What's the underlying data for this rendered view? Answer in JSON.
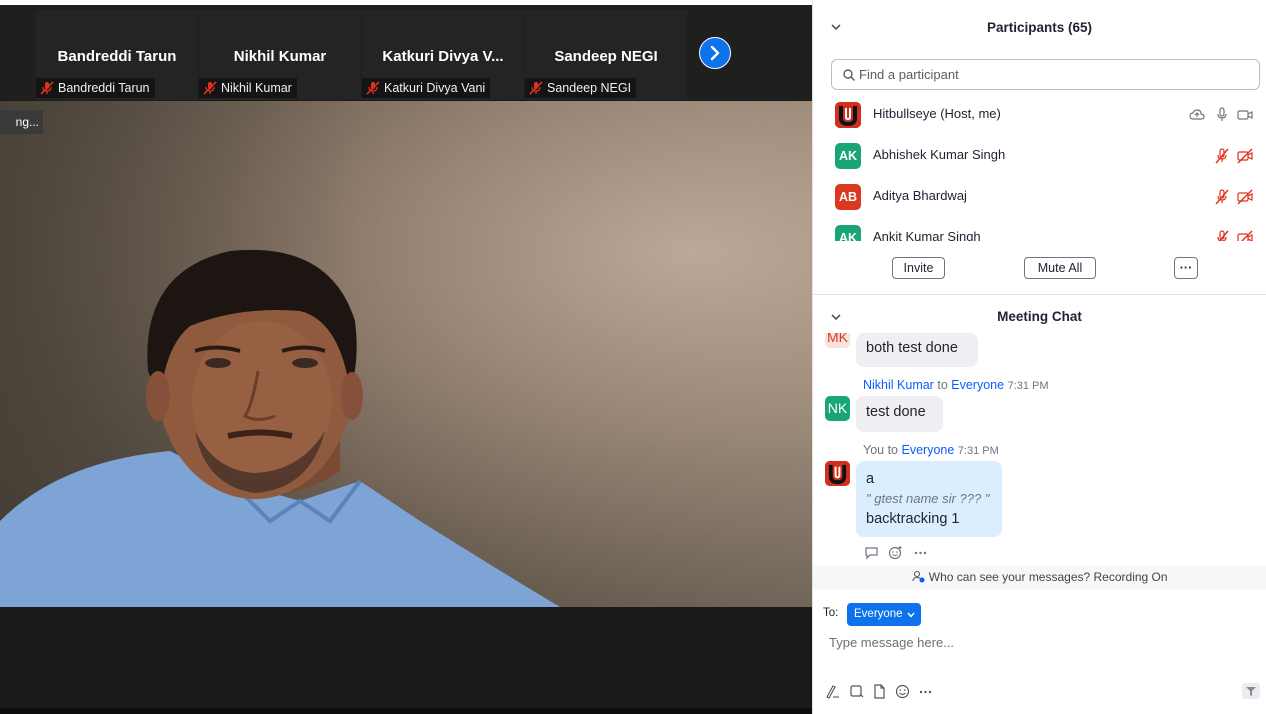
{
  "gallery": {
    "tiles": [
      {
        "name": "Bandreddi Tarun",
        "label": "Bandreddi Tarun"
      },
      {
        "name": "Nikhil  Kumar",
        "label": "Nikhil  Kumar"
      },
      {
        "name": "Katkuri Divya V...",
        "label": "Katkuri Divya Vani"
      },
      {
        "name": "Sandeep  NEGI",
        "label": "Sandeep  NEGI"
      }
    ]
  },
  "main_video": {
    "status_text": "ng..."
  },
  "participants": {
    "title": "Participants (65)",
    "search_placeholder": "Find a participant",
    "list": [
      {
        "name": "Hitbullseye (Host, me)",
        "initials": "",
        "avatar_color": "#d32f1f"
      },
      {
        "name": "Abhishek Kumar Singh",
        "initials": "AK",
        "avatar_color": "#1aa574"
      },
      {
        "name": "Aditya Bhardwaj",
        "initials": "AB",
        "avatar_color": "#d9391f"
      },
      {
        "name": "Ankit Kumar Singh",
        "initials": "AK",
        "avatar_color": "#1aa574"
      }
    ],
    "invite_label": "Invite",
    "mute_all_label": "Mute All",
    "more_label": "···"
  },
  "chat": {
    "title": "Meeting Chat",
    "messages": [
      {
        "initials": "MK",
        "text": "both test done"
      },
      {
        "sender": "Nikhil  Kumar",
        "to_word": "to",
        "recipient": "Everyone",
        "time": "7:31 PM",
        "initials": "NK",
        "text": "test done"
      },
      {
        "sender": "You",
        "to_word": "to",
        "recipient": "Everyone",
        "time": "7:31 PM",
        "line1": "a",
        "quote": "\" gtest name sir ??? \"",
        "line3": "backtracking 1"
      }
    ],
    "privacy_text": "Who can see your messages? Recording On",
    "to_label": "To:",
    "to_value": "Everyone",
    "input_placeholder": "Type message here..."
  },
  "colors": {
    "accent": "#0e72ed",
    "muted_red": "#e0301e",
    "link_blue": "#0b5cff"
  }
}
